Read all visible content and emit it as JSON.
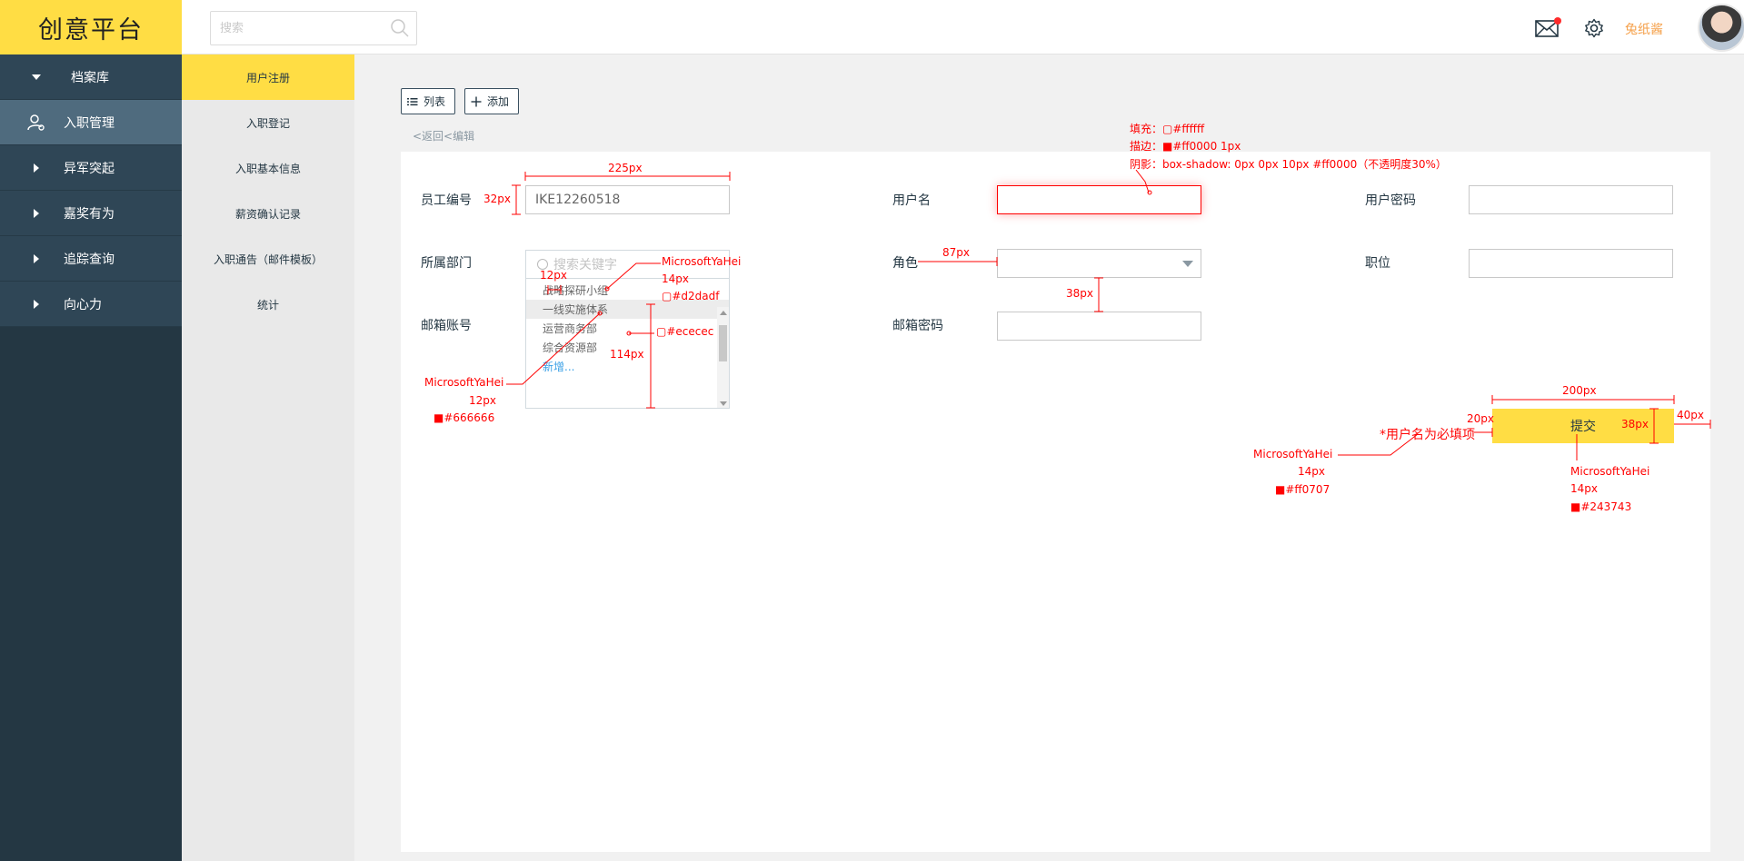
{
  "app": {
    "logo": "创意平台"
  },
  "topbar": {
    "search_placeholder": "搜索",
    "username": "兔纸酱",
    "icons": [
      "search-icon",
      "mail-icon",
      "gear-icon",
      "avatar"
    ]
  },
  "sidebar": {
    "items": [
      {
        "label": "档案库",
        "state": "expanded",
        "icon": "caret-down-icon"
      },
      {
        "label": "入职管理",
        "state": "active",
        "icon": "user-settings-icon"
      },
      {
        "label": "异军突起",
        "icon": "caret-right-icon"
      },
      {
        "label": "嘉奖有为",
        "icon": "caret-right-icon"
      },
      {
        "label": "追踪查询",
        "icon": "caret-right-icon"
      },
      {
        "label": "向心力",
        "icon": "caret-right-icon"
      }
    ]
  },
  "subnav": {
    "items": [
      "用户注册",
      "入职登记",
      "入职基本信息",
      "薪资确认记录",
      "入职通告（邮件模板）",
      "统计"
    ],
    "active": "用户注册"
  },
  "toolbar": {
    "list_label": "列表",
    "add_label": "添加"
  },
  "breadcrumb": "<返回<编辑",
  "form": {
    "employee_id_label": "员工编号",
    "employee_id_value": "IKE12260518",
    "username_label": "用户名",
    "password_label": "用户密码",
    "department_label": "所属部门",
    "role_label": "角色",
    "position_label": "职位",
    "email_label": "邮箱账号",
    "email_password_label": "邮箱密码",
    "dropdown": {
      "search_placeholder": "搜索关键字",
      "options": [
        "战略探研小组",
        "一线实施体系",
        "运营商务部",
        "综合资源部"
      ],
      "hovered_option": "一线实施体系",
      "add_label": "新增..."
    },
    "submit_label": "提交",
    "required_note": "*用户名为必填项"
  },
  "colors": {
    "brand_yellow": "#ffdd44",
    "nav_dark": "#243743",
    "annotation_red": "#ff0000",
    "error_red": "#ff0707",
    "dropdown_border": "#d2dadf",
    "hover_bg": "#ececec",
    "text_gray": "#666666",
    "username_orange": "#f5a04a"
  },
  "annotations": {
    "width_225": "225px",
    "height_32": "32px",
    "err_fill": "填充：▢#ffffff",
    "err_stroke": "描边：■#ff0000 1px",
    "err_shadow": "阴影：box-shadow: 0px 0px 10px #ff0000（不透明度30%）",
    "dd_font": "MicrosoftYaHei",
    "dd_size": "14px",
    "dd_color": "▢#d2dadf",
    "pad_12": "12px",
    "hover_color": "▢#ececec",
    "height_114": "114px",
    "opt_font": "MicrosoftYaHei",
    "opt_size": "12px",
    "opt_color": "■#666666",
    "width_87": "87px",
    "gap_38": "38px",
    "width_200": "200px",
    "gap_20": "20px",
    "height_38": "38px",
    "gap_40": "40px",
    "note_font": "MicrosoftYaHei",
    "note_size": "14px",
    "note_color": "■#ff0707",
    "btn_font": "MicrosoftYaHei",
    "btn_size": "14px",
    "btn_color": "■#243743"
  }
}
